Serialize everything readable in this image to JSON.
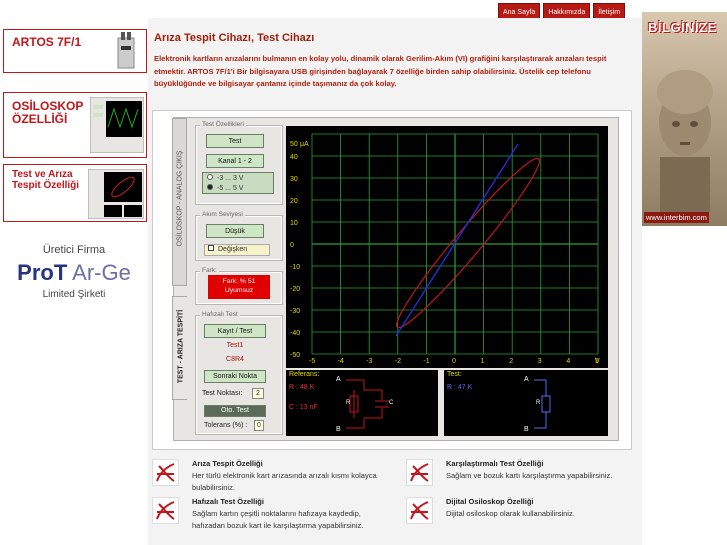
{
  "nav": {
    "items": [
      "Ana Sayfa",
      "Hakkımızda",
      "İletişim"
    ]
  },
  "right_banner": {
    "title": "BİLGİNİZE",
    "url": "www.interbim.com"
  },
  "sidebar": {
    "products": [
      {
        "label": "ARTOS 7F/1"
      },
      {
        "label": "OSİLOSKOP ÖZELLİĞİ"
      },
      {
        "label": "Test ve Arıza Tespit Özelliği"
      }
    ],
    "manufacturer": {
      "top": "Üretici Firma",
      "brand_a": "ProT",
      "brand_b": " Ar-Ge",
      "bottom": "Limited Şirketi"
    }
  },
  "page": {
    "title": "Arıza Tespit Cihazı, Test Cihazı",
    "intro": "Elektronik kartların arızalarını bulmanın en kolay yolu, dinamik olarak Gerilim-Akım (VI) grafiğini karşılaştırarak arızaları tespit etmektir. ARTOS 7F/1'i Bir bilgisayara USB girişinden bağlayarak 7 özelliğe birden sahip olabilirsiniz. Üstelik cep telefonu büyüklüğünde ve bilgisayar çantanız içinde taşımanız da çok kolay."
  },
  "app": {
    "side_tabs": {
      "top": "OSİLOSKOP - ANALOG ÇIKIŞ",
      "bottom": "TEST - ARIZA TESPİTİ"
    },
    "test_group": {
      "title": "Test Özellikleri",
      "test_btn": "Test",
      "channel_btn": "Kanal 1 - 2",
      "range1": "-3 ... 3 V",
      "range2": "-5 ... 5 V"
    },
    "current_group": {
      "title": "Akım Seviyesi",
      "low_btn": "Düşük",
      "variable_label": "Değişken"
    },
    "diff_group": {
      "title": "Fark:",
      "line1": "Fark: % 51",
      "line2": "Uyumsuz"
    },
    "memory_group": {
      "title": "Hafızalı Test",
      "record_btn": "Kayıt / Test",
      "name": "Test1",
      "code": "C8R4",
      "next_btn": "Sonraki Nokta",
      "point_label": "Test Noktası:",
      "point_value": "2",
      "auto_btn": "Oto. Test",
      "tol_label": "Tolerans (%) :",
      "tol_value": "0"
    },
    "plot": {
      "ylabel": "μA",
      "xlabel": "V",
      "x_ticks": [
        "-5",
        "-4",
        "-3",
        "-2",
        "-1",
        "0",
        "1",
        "2",
        "3",
        "4",
        "5"
      ],
      "y_ticks": [
        "50",
        "40",
        "30",
        "20",
        "10",
        "0",
        "-10",
        "-20",
        "-30",
        "-40",
        "-50"
      ],
      "grid_color": "#2e9e38",
      "ellipse_red": "#c0171c",
      "line_blue": "#2a2ad4"
    },
    "ref_panel": {
      "title": "Referans:",
      "r": "R : 48 K",
      "c": "C : 13 nF",
      "a": "A",
      "b": "B",
      "r_sym": "R",
      "c_sym": "C"
    },
    "test_panel": {
      "title": "Test:",
      "r": "R : 47 K",
      "a": "A",
      "b": "B",
      "r_sym": "R"
    }
  },
  "features": [
    {
      "title": "Arıza Tespit Özelliği",
      "desc": "Her türlü elektronik kart arızasında arızalı kısmı kolayca bulabilirsiniz."
    },
    {
      "title": "Karşılaştırmalı Test Özelliği",
      "desc": "Sağlam ve bozuk kartı karşılaştırma yapabilirsiniz."
    },
    {
      "title": "Hafızalı Test Özelliği",
      "desc": "Sağlam kartın çeşitli noktalarını hafızaya kaydedip, hafızadan bozuk kart ile karşılaştırma yapabilirsiniz."
    },
    {
      "title": "Dijital Osiloskop Özelliği",
      "desc": "Dijital osiloskop olarak kullanabilirsiniz."
    }
  ]
}
